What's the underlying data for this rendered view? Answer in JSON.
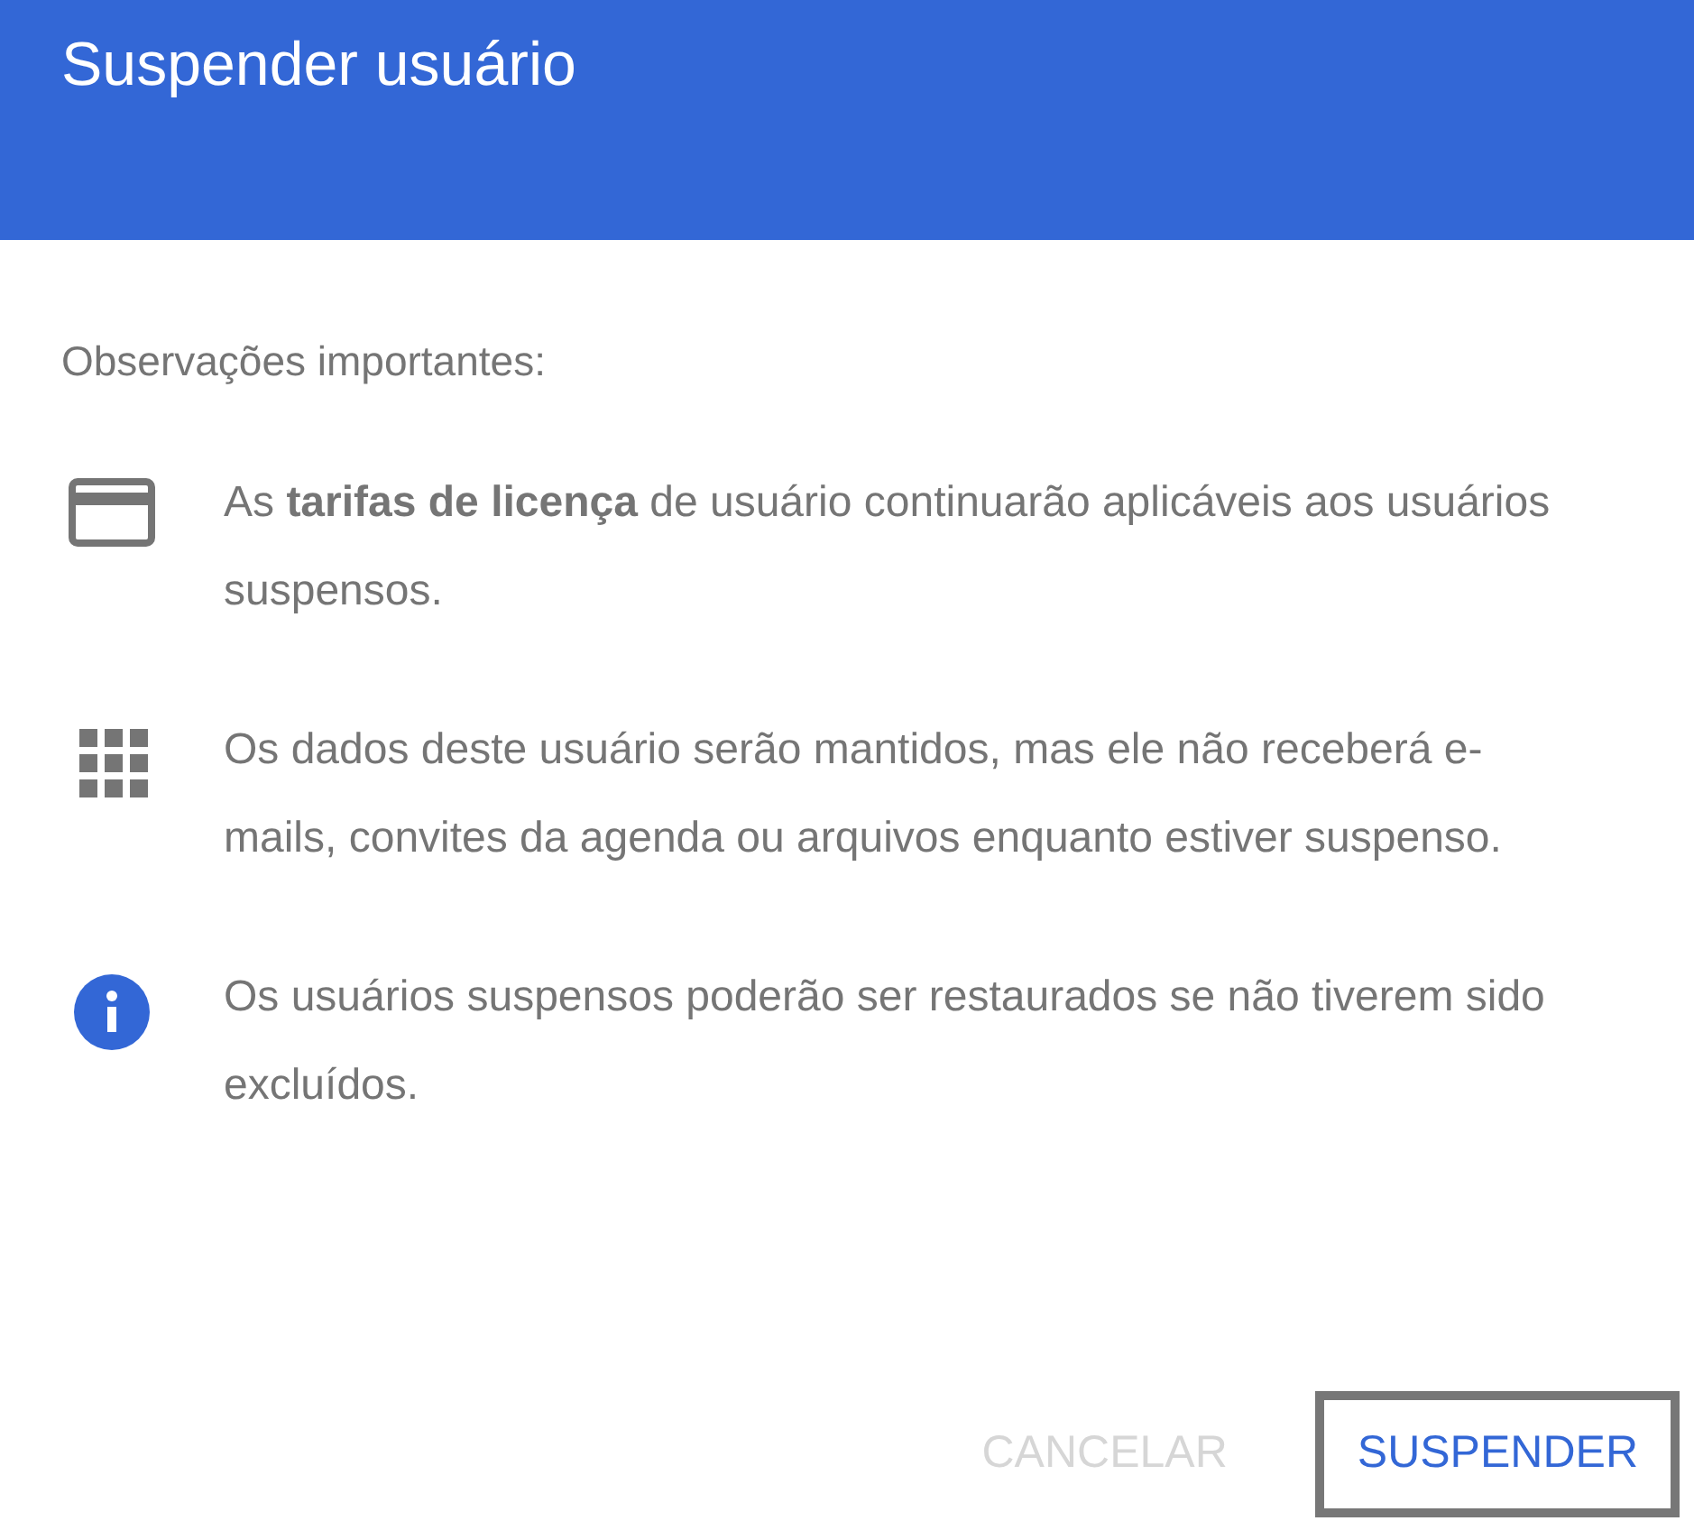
{
  "dialog": {
    "title": "Suspender usuário",
    "intro": "Observações importantes:",
    "notes": [
      {
        "kind": "card",
        "text": "As **tarifas de licença** de usuário continuarão aplicáveis aos usuários suspensos."
      },
      {
        "kind": "apps",
        "text": "Os dados deste usuário serão mantidos, mas ele não receberá e-mails, convites da agenda ou arquivos enquanto estiver suspenso."
      },
      {
        "kind": "info",
        "text": "Os usuários suspensos poderão ser restaurados se não tiverem sido excluídos."
      }
    ],
    "buttons": [
      {
        "label": "CANCELAR",
        "disabled": true,
        "highlighted": false
      },
      {
        "label": "SUSPENDER",
        "disabled": false,
        "highlighted": true
      }
    ]
  }
}
